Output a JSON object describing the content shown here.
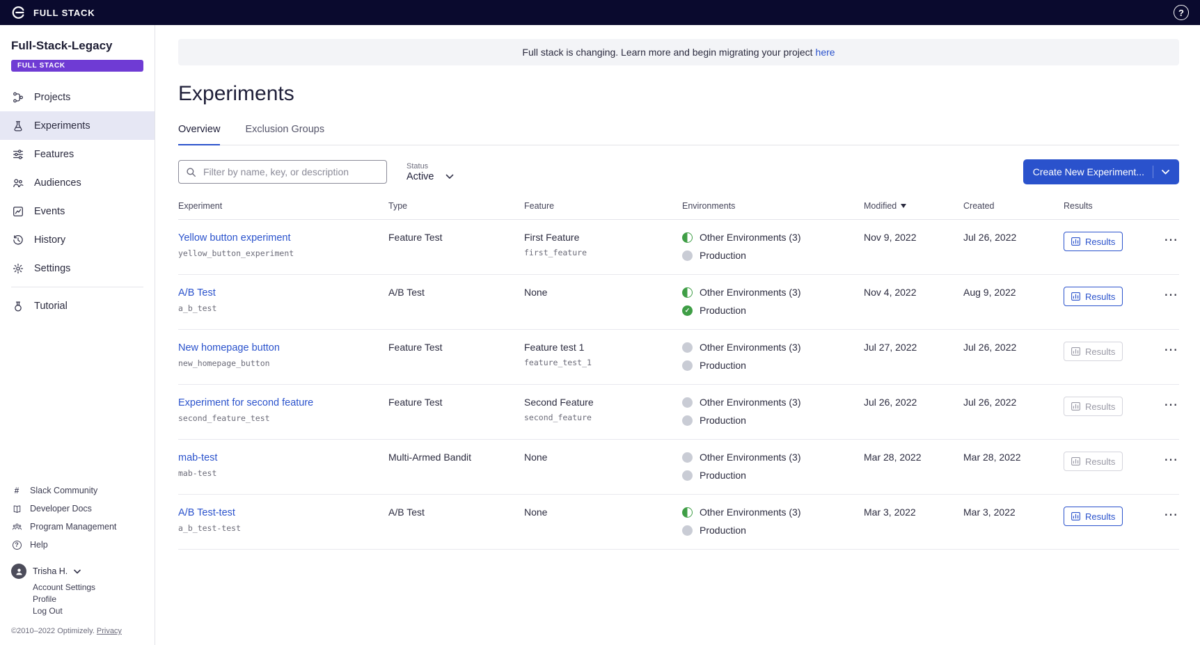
{
  "colors": {
    "accent_blue": "#2a52cc",
    "badge_purple": "#6f3bd4",
    "status_green": "#3f9e46",
    "topbar_navy": "#0a0a2e",
    "selected_nav_bg": "#e6e7f4"
  },
  "topbar": {
    "brand": "FULL STACK"
  },
  "sidebar": {
    "project_name": "Full-Stack-Legacy",
    "badge": "FULL STACK",
    "items": [
      {
        "label": "Projects"
      },
      {
        "label": "Experiments"
      },
      {
        "label": "Features"
      },
      {
        "label": "Audiences"
      },
      {
        "label": "Events"
      },
      {
        "label": "History"
      },
      {
        "label": "Settings"
      },
      {
        "label": "Tutorial"
      }
    ],
    "footer_links": [
      {
        "label": "Slack Community"
      },
      {
        "label": "Developer Docs"
      },
      {
        "label": "Program Management"
      },
      {
        "label": "Help"
      }
    ],
    "user": {
      "name": "Trisha H.",
      "links": [
        "Account Settings",
        "Profile",
        "Log Out"
      ]
    },
    "copyright": "©2010–2022 Optimizely.",
    "privacy": "Privacy"
  },
  "banner": {
    "text": "Full stack is changing. Learn more and begin migrating your project",
    "link": "here"
  },
  "page": {
    "title": "Experiments",
    "tabs": [
      {
        "label": "Overview",
        "active": true
      },
      {
        "label": "Exclusion Groups",
        "active": false
      }
    ]
  },
  "controls": {
    "filter_placeholder": "Filter by name, key, or description",
    "status_label": "Status",
    "status_value": "Active",
    "create_button": "Create New Experiment..."
  },
  "table": {
    "headers": [
      "Experiment",
      "Type",
      "Feature",
      "Environments",
      "Modified",
      "Created",
      "Results"
    ],
    "results_label": "Results",
    "rows": [
      {
        "name": "Yellow button experiment",
        "key": "yellow_button_experiment",
        "type": "Feature Test",
        "feature": "First Feature",
        "feature_key": "first_feature",
        "env_other_label": "Other Environments (3)",
        "env_other_state": "partial",
        "env_prod_label": "Production",
        "env_prod_state": "off",
        "modified": "Nov 9, 2022",
        "created": "Jul 26, 2022",
        "results_enabled": true
      },
      {
        "name": "A/B Test",
        "key": "a_b_test",
        "type": "A/B Test",
        "feature": "None",
        "feature_key": "",
        "env_other_label": "Other Environments (3)",
        "env_other_state": "partial",
        "env_prod_label": "Production",
        "env_prod_state": "running",
        "modified": "Nov 4, 2022",
        "created": "Aug 9, 2022",
        "results_enabled": true
      },
      {
        "name": "New homepage button",
        "key": "new_homepage_button",
        "type": "Feature Test",
        "feature": "Feature test 1",
        "feature_key": "feature_test_1",
        "env_other_label": "Other Environments (3)",
        "env_other_state": "off",
        "env_prod_label": "Production",
        "env_prod_state": "off",
        "modified": "Jul 27, 2022",
        "created": "Jul 26, 2022",
        "results_enabled": false
      },
      {
        "name": "Experiment for second feature",
        "key": "second_feature_test",
        "type": "Feature Test",
        "feature": "Second Feature",
        "feature_key": "second_feature",
        "env_other_label": "Other Environments (3)",
        "env_other_state": "off",
        "env_prod_label": "Production",
        "env_prod_state": "off",
        "modified": "Jul 26, 2022",
        "created": "Jul 26, 2022",
        "results_enabled": false
      },
      {
        "name": "mab-test",
        "key": "mab-test",
        "type": "Multi-Armed Bandit",
        "feature": "None",
        "feature_key": "",
        "env_other_label": "Other Environments (3)",
        "env_other_state": "off",
        "env_prod_label": "Production",
        "env_prod_state": "off",
        "modified": "Mar 28, 2022",
        "created": "Mar 28, 2022",
        "results_enabled": false
      },
      {
        "name": "A/B Test-test",
        "key": "a_b_test-test",
        "type": "A/B Test",
        "feature": "None",
        "feature_key": "",
        "env_other_label": "Other Environments (3)",
        "env_other_state": "partial",
        "env_prod_label": "Production",
        "env_prod_state": "off",
        "modified": "Mar 3, 2022",
        "created": "Mar 3, 2022",
        "results_enabled": true
      }
    ]
  }
}
